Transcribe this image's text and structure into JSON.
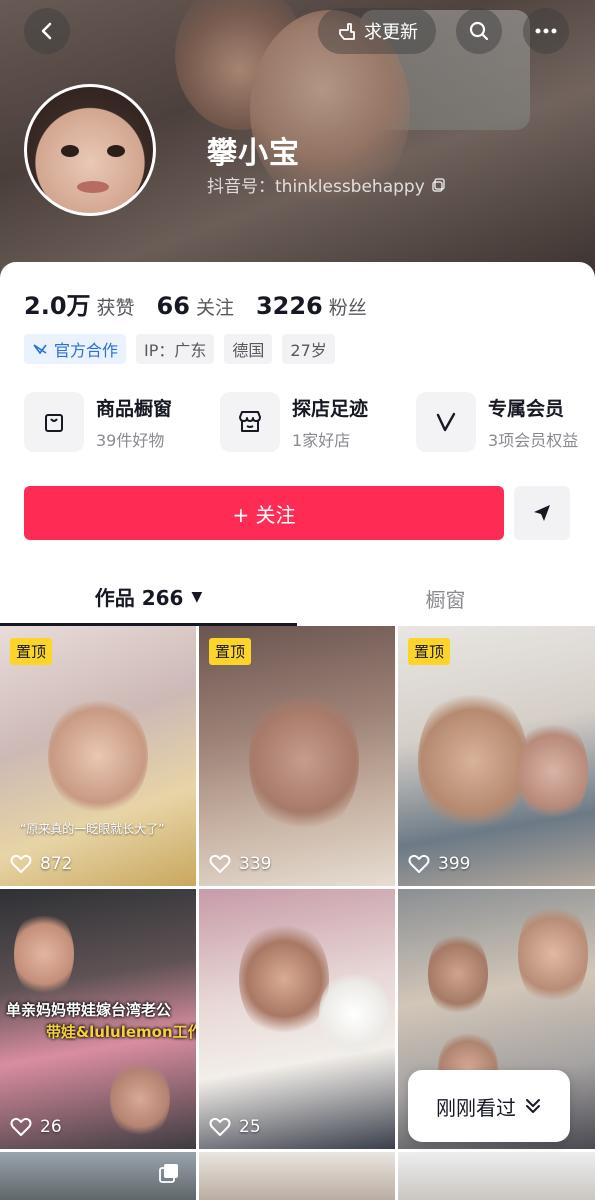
{
  "header": {
    "update_label": "求更新",
    "nickname": "攀小宝",
    "douyin_id_label": "抖音号：thinklessbehappy"
  },
  "stats": {
    "likes_num": "2.0万",
    "likes_label": "获赞",
    "following_num": "66",
    "following_label": "关注",
    "followers_num": "3226",
    "followers_label": "粉丝"
  },
  "tags": {
    "official": "官方合作",
    "ip": "IP：广东",
    "country": "德国",
    "age": "27岁"
  },
  "features": [
    {
      "title": "商品橱窗",
      "sub": "39件好物"
    },
    {
      "title": "探店足迹",
      "sub": "1家好店"
    },
    {
      "title": "专属会员",
      "sub": "3项会员权益"
    }
  ],
  "follow_label": "+ 关注",
  "tabs": {
    "works": "作品 266",
    "showcase": "橱窗"
  },
  "videos": [
    {
      "pinned": "置顶",
      "likes": "872",
      "caption": "“原来真的一眨眼就长大了”"
    },
    {
      "pinned": "置顶",
      "likes": "339"
    },
    {
      "pinned": "置顶",
      "likes": "399"
    },
    {
      "likes": "26",
      "overlay1": "单亲妈妈带娃嫁台湾老公",
      "overlay2": "带娃&lululemon工作"
    },
    {
      "likes": "25"
    },
    {
      "likes": ""
    }
  ],
  "recent_label": "刚刚看过"
}
